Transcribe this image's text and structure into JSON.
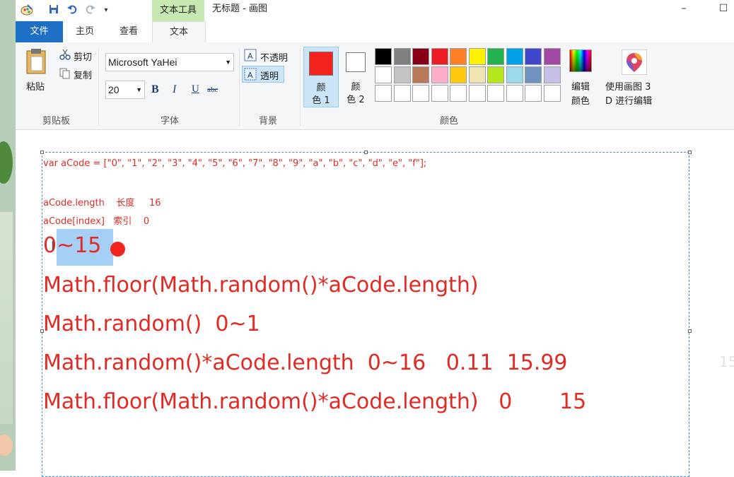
{
  "window": {
    "title": "无标题 - 画图",
    "context_tab": "文本工具",
    "minimize": "–",
    "maximize": "☐"
  },
  "tabs": {
    "file": "文件",
    "home": "主页",
    "view": "查看",
    "text": "文本"
  },
  "clipboard": {
    "paste": "粘贴",
    "cut": "剪切",
    "copy": "复制",
    "group": "剪贴板"
  },
  "font": {
    "family": "Microsoft YaHei",
    "size": "20",
    "bold": "B",
    "italic": "I",
    "underline": "U",
    "strike": "abc",
    "group": "字体"
  },
  "background": {
    "opaque": "不透明",
    "transparent": "透明",
    "group": "背景"
  },
  "colors": {
    "color1_line1": "颜",
    "color1_line2": "色 1",
    "color2_line1": "颜",
    "color2_line2": "色 2",
    "edit_line1": "编辑",
    "edit_line2": "颜色",
    "paint3d_line1": "使用画图 3",
    "paint3d_line2": "D 进行编辑",
    "group": "颜色",
    "color1_value": "#f2241d",
    "color2_value": "#ffffff",
    "palette_row1": [
      "#000000",
      "#7f7f7f",
      "#880015",
      "#ed1c24",
      "#ff7f27",
      "#fff200",
      "#22b14c",
      "#00a2e8",
      "#3f48cc",
      "#a349a4"
    ],
    "palette_row2": [
      "#ffffff",
      "#c3c3c3",
      "#b97a57",
      "#ffaec9",
      "#ffc90e",
      "#efe4b0",
      "#b5e61d",
      "#99d9ea",
      "#7092be",
      "#c8bfe7"
    ],
    "palette_row3": [
      "#ffffff",
      "#ffffff",
      "#ffffff",
      "#ffffff",
      "#ffffff",
      "#ffffff",
      "#ffffff",
      "#ffffff",
      "#ffffff",
      "#ffffff"
    ]
  },
  "canvas": {
    "line1": "var aCode = [\"0\", \"1\", \"2\", \"3\", \"4\", \"5\", \"6\", \"7\", \"8\", \"9\", \"a\", \"b\", \"c\", \"d\", \"e\", \"f\"];",
    "line2": "aCode.length    长度     16",
    "line3": "aCode[index]   索引    0",
    "line4": "0~15",
    "line5": "Math.floor(Math.random()*aCode.length)",
    "line6": "Math.random()  0~1",
    "line7": "Math.random()*aCode.length  0~16   0.11  15.99",
    "line8": "Math.floor(Math.random()*aCode.length)   0       15",
    "ghost_text": "15"
  }
}
